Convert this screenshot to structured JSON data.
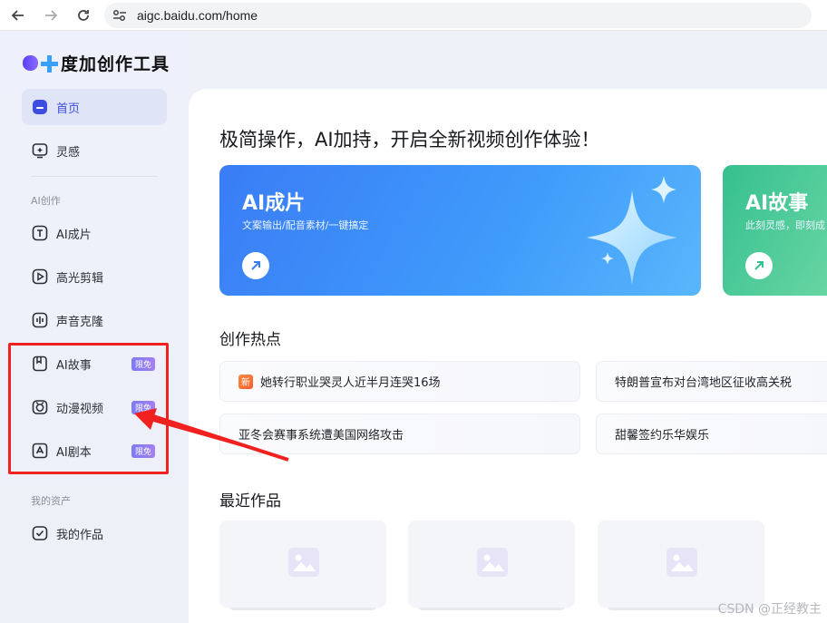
{
  "browser": {
    "url": "aigc.baidu.com/home"
  },
  "sidebar": {
    "logo_text": "度加创作工具",
    "items_top": [
      {
        "label": "首页",
        "icon": "home-icon"
      },
      {
        "label": "灵感",
        "icon": "inspiration-icon"
      }
    ],
    "section_ai": "AI创作",
    "items_ai": [
      {
        "label": "AI成片",
        "icon": "ai-video-icon"
      },
      {
        "label": "高光剪辑",
        "icon": "highlight-clip-icon"
      },
      {
        "label": "声音克隆",
        "icon": "voice-clone-icon"
      },
      {
        "label": "AI故事",
        "icon": "ai-story-icon",
        "badge": "限免"
      },
      {
        "label": "动漫视频",
        "icon": "anime-video-icon",
        "badge": "限免"
      },
      {
        "label": "AI剧本",
        "icon": "ai-script-icon",
        "badge": "限免"
      }
    ],
    "section_assets": "我的资产",
    "items_assets": [
      {
        "label": "我的作品",
        "icon": "my-works-icon"
      }
    ]
  },
  "main": {
    "headline": "极简操作，AI加持，开启全新视频创作体验！",
    "cards": [
      {
        "title": "AI成片",
        "subtitle": "文案输出/配音素材/一键搞定",
        "color": "#3a7cf6"
      },
      {
        "title": "AI故事",
        "subtitle": "此刻灵感，即刻成",
        "color": "#36c08f"
      }
    ],
    "hot_title": "创作热点",
    "hot_items": [
      {
        "text": "她转行职业哭灵人近半月连哭16场",
        "tag": "新"
      },
      {
        "text": "特朗普宣布对台湾地区征收高关税"
      },
      {
        "text": "亚冬会赛事系统遭美国网络攻击"
      },
      {
        "text": "甜馨签约乐华娱乐"
      }
    ],
    "recent_title": "最近作品"
  },
  "watermark": "CSDN @正经教主",
  "colors": {
    "accent": "#3d4de0",
    "highlight": "#f0211e",
    "badge": "#8a7df3"
  }
}
